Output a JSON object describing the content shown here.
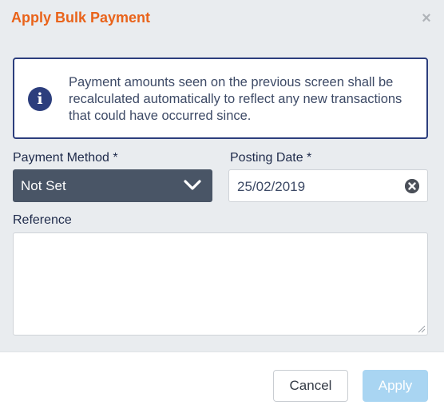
{
  "dialog": {
    "title": "Apply Bulk Payment",
    "close_label": "×"
  },
  "info": {
    "icon": "info-icon",
    "icon_glyph": "i",
    "message": "Payment amounts seen on the previous screen shall be recalculated automatically to reflect any new transactions that could have occurred since."
  },
  "form": {
    "payment_method": {
      "label": "Payment Method *",
      "value": "Not Set"
    },
    "posting_date": {
      "label": "Posting Date *",
      "value": "25/02/2019"
    },
    "reference": {
      "label": "Reference",
      "value": ""
    }
  },
  "footer": {
    "cancel_label": "Cancel",
    "apply_label": "Apply"
  },
  "colors": {
    "title": "#e9631a",
    "info_border": "#2c3e7d",
    "select_bg": "#495566",
    "apply_disabled": "#a9d5f2"
  }
}
